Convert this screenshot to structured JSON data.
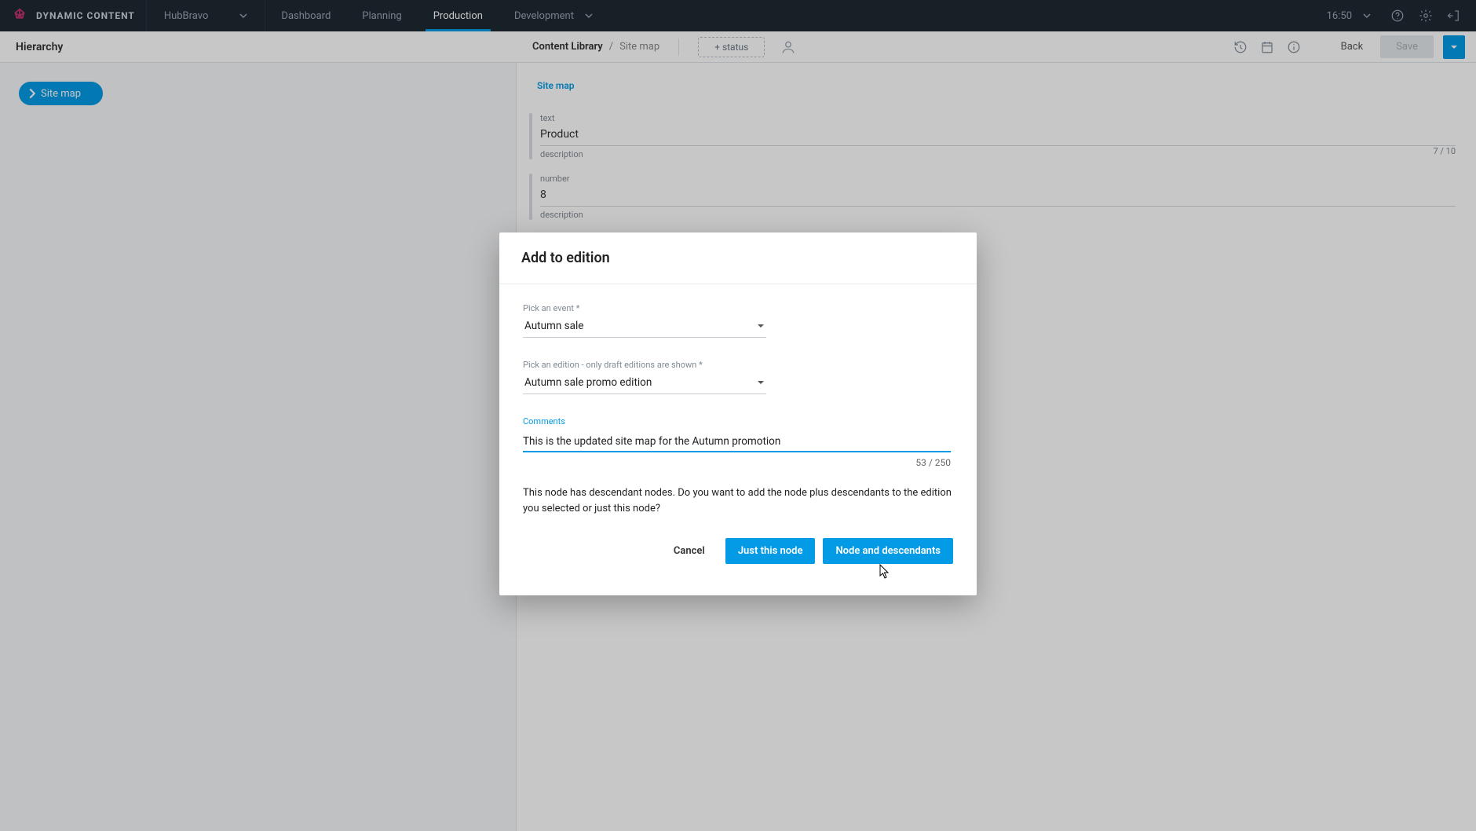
{
  "brand": "DYNAMIC CONTENT",
  "hub": "HubBravo",
  "nav": {
    "dashboard": "Dashboard",
    "planning": "Planning",
    "production": "Production",
    "development": "Development"
  },
  "clock": "16:50",
  "leftPanel": {
    "title": "Hierarchy",
    "chip": "Site map"
  },
  "breadcrumb": {
    "root": "Content Library",
    "leaf": "Site map",
    "status": "+ status"
  },
  "secondaryActions": {
    "back": "Back",
    "save": "Save"
  },
  "miniCrumb": "Site map",
  "fields": {
    "text": {
      "label": "text",
      "value": "Product",
      "desc": "description",
      "count": "7 / 10"
    },
    "number": {
      "label": "number",
      "value": "8",
      "desc": "description"
    }
  },
  "modal": {
    "title": "Add to edition",
    "eventLabel": "Pick an event *",
    "eventValue": "Autumn sale",
    "editionLabel": "Pick an edition - only draft editions are shown *",
    "editionValue": "Autumn sale promo edition",
    "commentsLabel": "Comments",
    "commentsValue": "This is the updated site map for the Autumn promotion",
    "commentsCount": "53 / 250",
    "descendantsText": "This node has descendant nodes. Do you want to add the node plus descendants to the edition you selected or just this node?",
    "cancel": "Cancel",
    "justThis": "Just this node",
    "nodeAndDesc": "Node and descendants"
  }
}
